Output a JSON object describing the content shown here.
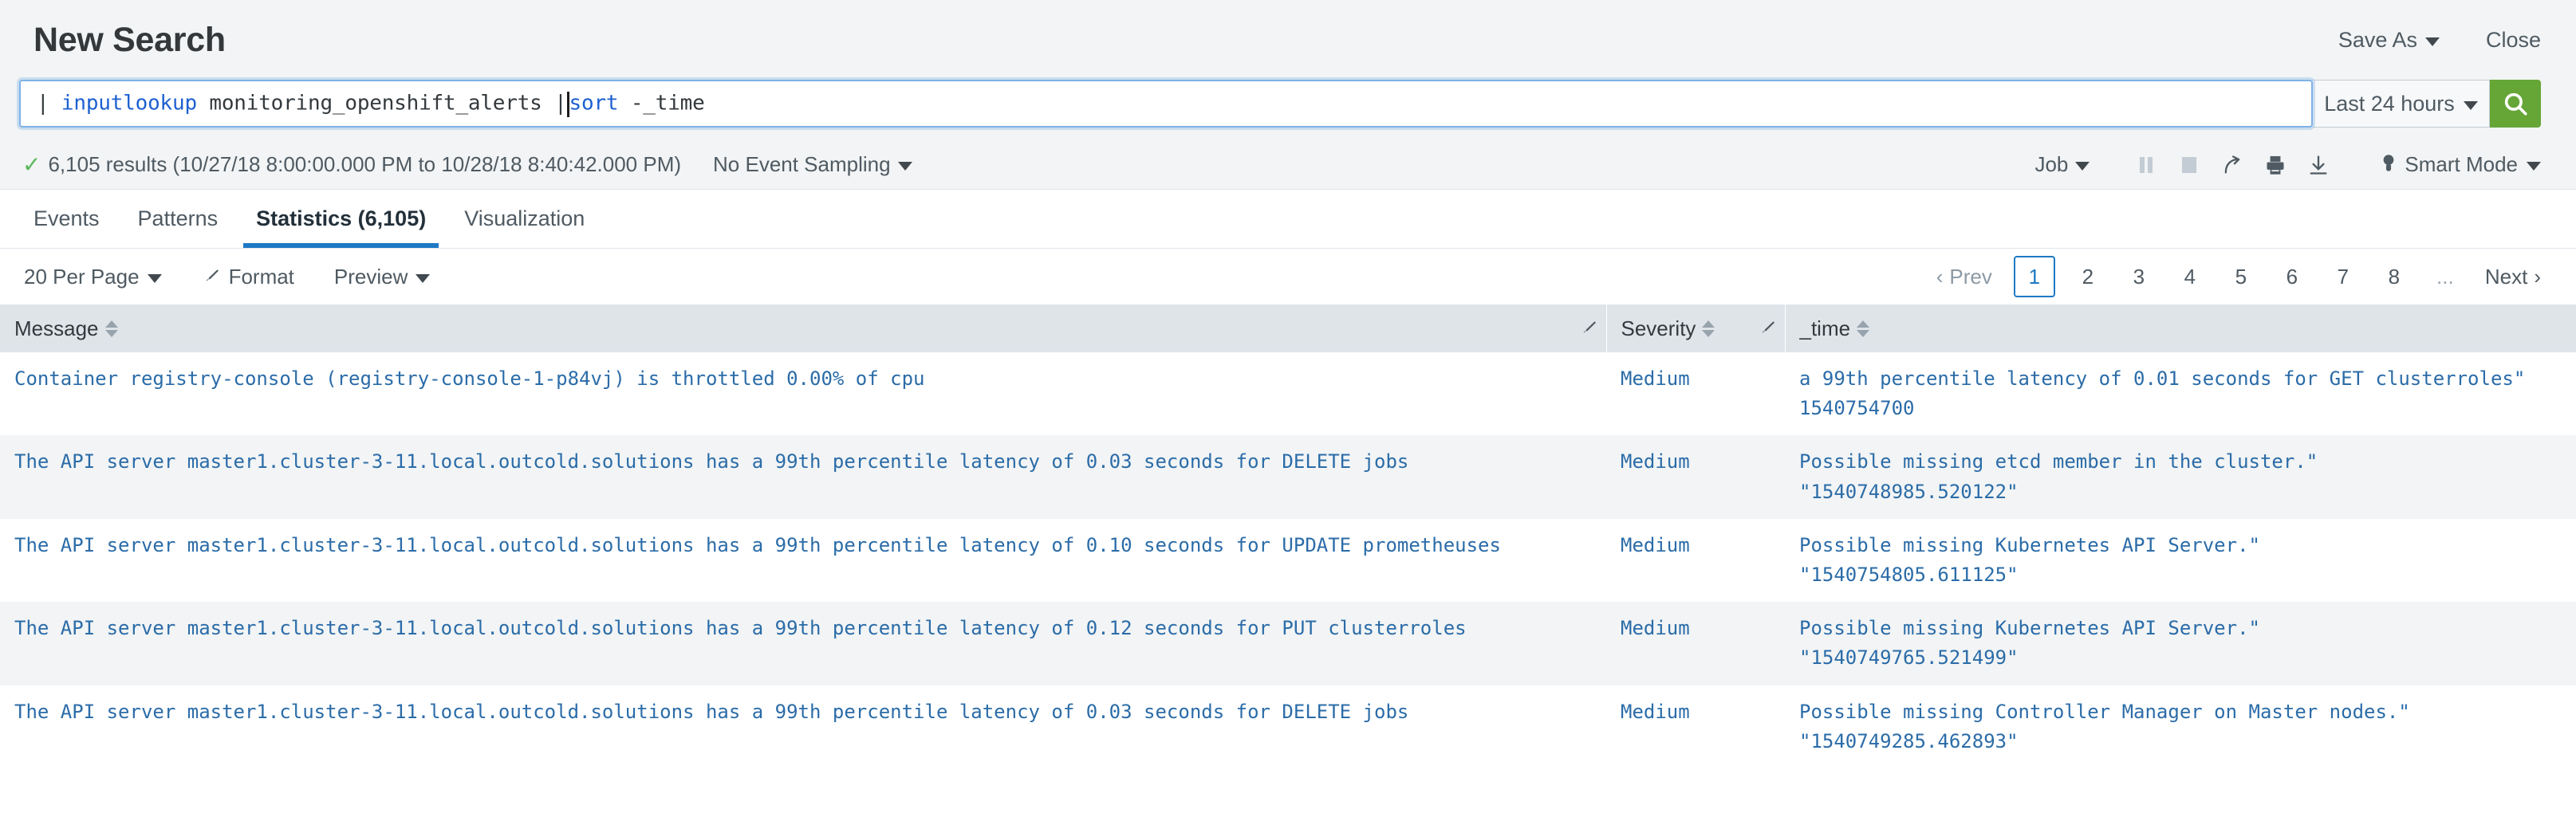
{
  "header": {
    "title": "New Search",
    "save_as_label": "Save As",
    "close_label": "Close"
  },
  "search": {
    "query_full": "| inputlookup monitoring_openshift_alerts || sort -_time",
    "query_pipe1": "| ",
    "query_cmd1": "inputlookup",
    "query_arg1": " monitoring_openshift_alerts ",
    "query_pipe2": "|",
    "query_cmd2": "sort",
    "query_arg2": " -_time",
    "time_range": "Last 24 hours",
    "submit_icon": "search-icon"
  },
  "results_bar": {
    "status_icon": "check-icon",
    "count_text": "6,105 results (10/27/18 8:00:00.000 PM to 10/28/18 8:40:42.000 PM)",
    "sampling_label": "No Event Sampling",
    "job_label": "Job",
    "pause_icon": "pause-icon",
    "stop_icon": "stop-icon",
    "share_icon": "share-icon",
    "print_icon": "print-icon",
    "export_icon": "download-icon",
    "mode_icon": "lightbulb-icon",
    "mode_label": "Smart Mode"
  },
  "tabs": [
    {
      "label": "Events",
      "active": false
    },
    {
      "label": "Patterns",
      "active": false
    },
    {
      "label": "Statistics (6,105)",
      "active": true
    },
    {
      "label": "Visualization",
      "active": false
    }
  ],
  "table_toolbar": {
    "per_page_label": "20 Per Page",
    "format_label": "Format",
    "format_icon": "brush-icon",
    "preview_label": "Preview",
    "prev_label": "Prev",
    "next_label": "Next",
    "pages": [
      "1",
      "2",
      "3",
      "4",
      "5",
      "6",
      "7",
      "8",
      "..."
    ],
    "current_page": "1"
  },
  "table": {
    "columns": [
      {
        "label": "Message",
        "sortable": true,
        "edit_icon": "brush-icon"
      },
      {
        "label": "Severity",
        "sortable": true,
        "edit_icon": "brush-icon"
      },
      {
        "label": "_time",
        "sortable": true,
        "edit_icon": null
      }
    ],
    "rows": [
      {
        "message": "Container registry-console (registry-console-1-p84vj) is throttled 0.00% of cpu",
        "severity": "Medium",
        "time_line1": "a 99th percentile latency of 0.01 seconds for GET clusterroles\"",
        "time_line2": "1540754700"
      },
      {
        "message": "The API server master1.cluster-3-11.local.outcold.solutions has a 99th percentile latency of 0.03 seconds for DELETE jobs",
        "severity": "Medium",
        "time_line1": "Possible missing etcd member in the cluster.\"",
        "time_line2": "\"1540748985.520122\""
      },
      {
        "message": "The API server master1.cluster-3-11.local.outcold.solutions has a 99th percentile latency of 0.10 seconds for UPDATE prometheuses",
        "severity": "Medium",
        "time_line1": "Possible missing Kubernetes API Server.\"",
        "time_line2": "\"1540754805.611125\""
      },
      {
        "message": "The API server master1.cluster-3-11.local.outcold.solutions has a 99th percentile latency of 0.12 seconds for PUT clusterroles",
        "severity": "Medium",
        "time_line1": "Possible missing Kubernetes API Server.\"",
        "time_line2": "\"1540749765.521499\""
      },
      {
        "message": "The API server master1.cluster-3-11.local.outcold.solutions has a 99th percentile latency of 0.03 seconds for DELETE jobs",
        "severity": "Medium",
        "time_line1": "Possible missing Controller Manager on Master nodes.\"",
        "time_line2": "\"1540749285.462893\""
      }
    ]
  },
  "colors": {
    "accent_blue": "#1e79c4",
    "submit_green": "#65a637",
    "cell_text": "#2b6ca8",
    "header_bg": "#dfe4e9",
    "chrome_bg": "#f2f4f5"
  }
}
